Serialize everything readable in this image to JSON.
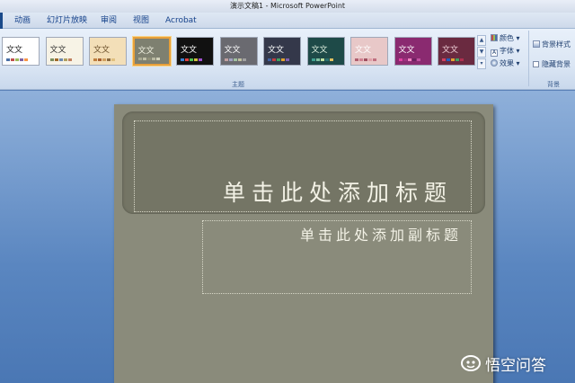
{
  "window": {
    "title": "演示文稿1 - Microsoft PowerPoint"
  },
  "tabs": [
    {
      "label": "动画"
    },
    {
      "label": "幻灯片放映"
    },
    {
      "label": "审阅"
    },
    {
      "label": "视图"
    },
    {
      "label": "Acrobat"
    }
  ],
  "themes": [
    {
      "label": "文文",
      "bg": "#ffffff",
      "fg": "#222222",
      "swatches": [
        "#4a6fa5",
        "#c0504d",
        "#9bbb59",
        "#8064a2",
        "#f79646"
      ]
    },
    {
      "label": "文文",
      "bg": "#f7f3e6",
      "fg": "#333333",
      "swatches": [
        "#7d8f60",
        "#a06a2a",
        "#6e8bb0",
        "#b0a060",
        "#c08060"
      ]
    },
    {
      "label": "文文",
      "bg": "#f3dfb8",
      "fg": "#6a4f2a",
      "swatches": [
        "#c08040",
        "#a86030",
        "#d0a060",
        "#8a6a40",
        "#e0c080"
      ]
    },
    {
      "label": "文文",
      "bg": "#7e8070",
      "fg": "#f0f0e0",
      "swatches": [
        "#a8a890",
        "#c0c0a8",
        "#909078",
        "#b8b8a0",
        "#d0d0b8"
      ],
      "selected": true
    },
    {
      "label": "文文",
      "bg": "#111111",
      "fg": "#ffffff",
      "swatches": [
        "#3a7fd0",
        "#e04040",
        "#50c050",
        "#d0c040",
        "#a050d0"
      ]
    },
    {
      "label": "文文",
      "bg": "#6a6a70",
      "fg": "#ffffff",
      "swatches": [
        "#c0a0a0",
        "#a0a0c0",
        "#a0c0a0",
        "#c0c0a0",
        "#a0a0a0"
      ]
    },
    {
      "label": "文文",
      "bg": "#34384a",
      "fg": "#ffffff",
      "swatches": [
        "#4060a0",
        "#c04040",
        "#40a060",
        "#e0a030",
        "#8060b0"
      ]
    },
    {
      "label": "文文",
      "bg": "#1e4a48",
      "fg": "#e0f0e0",
      "swatches": [
        "#40a090",
        "#80c0a0",
        "#c0e0a0",
        "#2a7070",
        "#e0c060"
      ]
    },
    {
      "label": "文文",
      "bg": "#e8c8c8",
      "fg": "#ffffff",
      "swatches": [
        "#b06070",
        "#d08090",
        "#a05060",
        "#e0a0a8",
        "#c07080"
      ]
    },
    {
      "label": "文文",
      "bg": "#8a2a70",
      "fg": "#ffffff",
      "swatches": [
        "#e040a0",
        "#a03080",
        "#f080c0",
        "#6a2060",
        "#c050a0"
      ]
    },
    {
      "label": "文文",
      "bg": "#6a2a40",
      "fg": "#f0d0d8",
      "swatches": [
        "#d04060",
        "#2060c0",
        "#e0a030",
        "#40a060",
        "#b03050"
      ]
    }
  ],
  "theme_options": {
    "colors": "颜色",
    "fonts": "字体",
    "effects": "效果"
  },
  "background_group": {
    "styles_button": "背景样式",
    "hide_graphics": "隐藏背景"
  },
  "group_labels": {
    "themes": "主题",
    "background": "背景"
  },
  "slide": {
    "title_placeholder": "单击此处添加标题",
    "subtitle_placeholder": "单击此处添加副标题"
  },
  "watermark": {
    "text": "悟空问答"
  }
}
